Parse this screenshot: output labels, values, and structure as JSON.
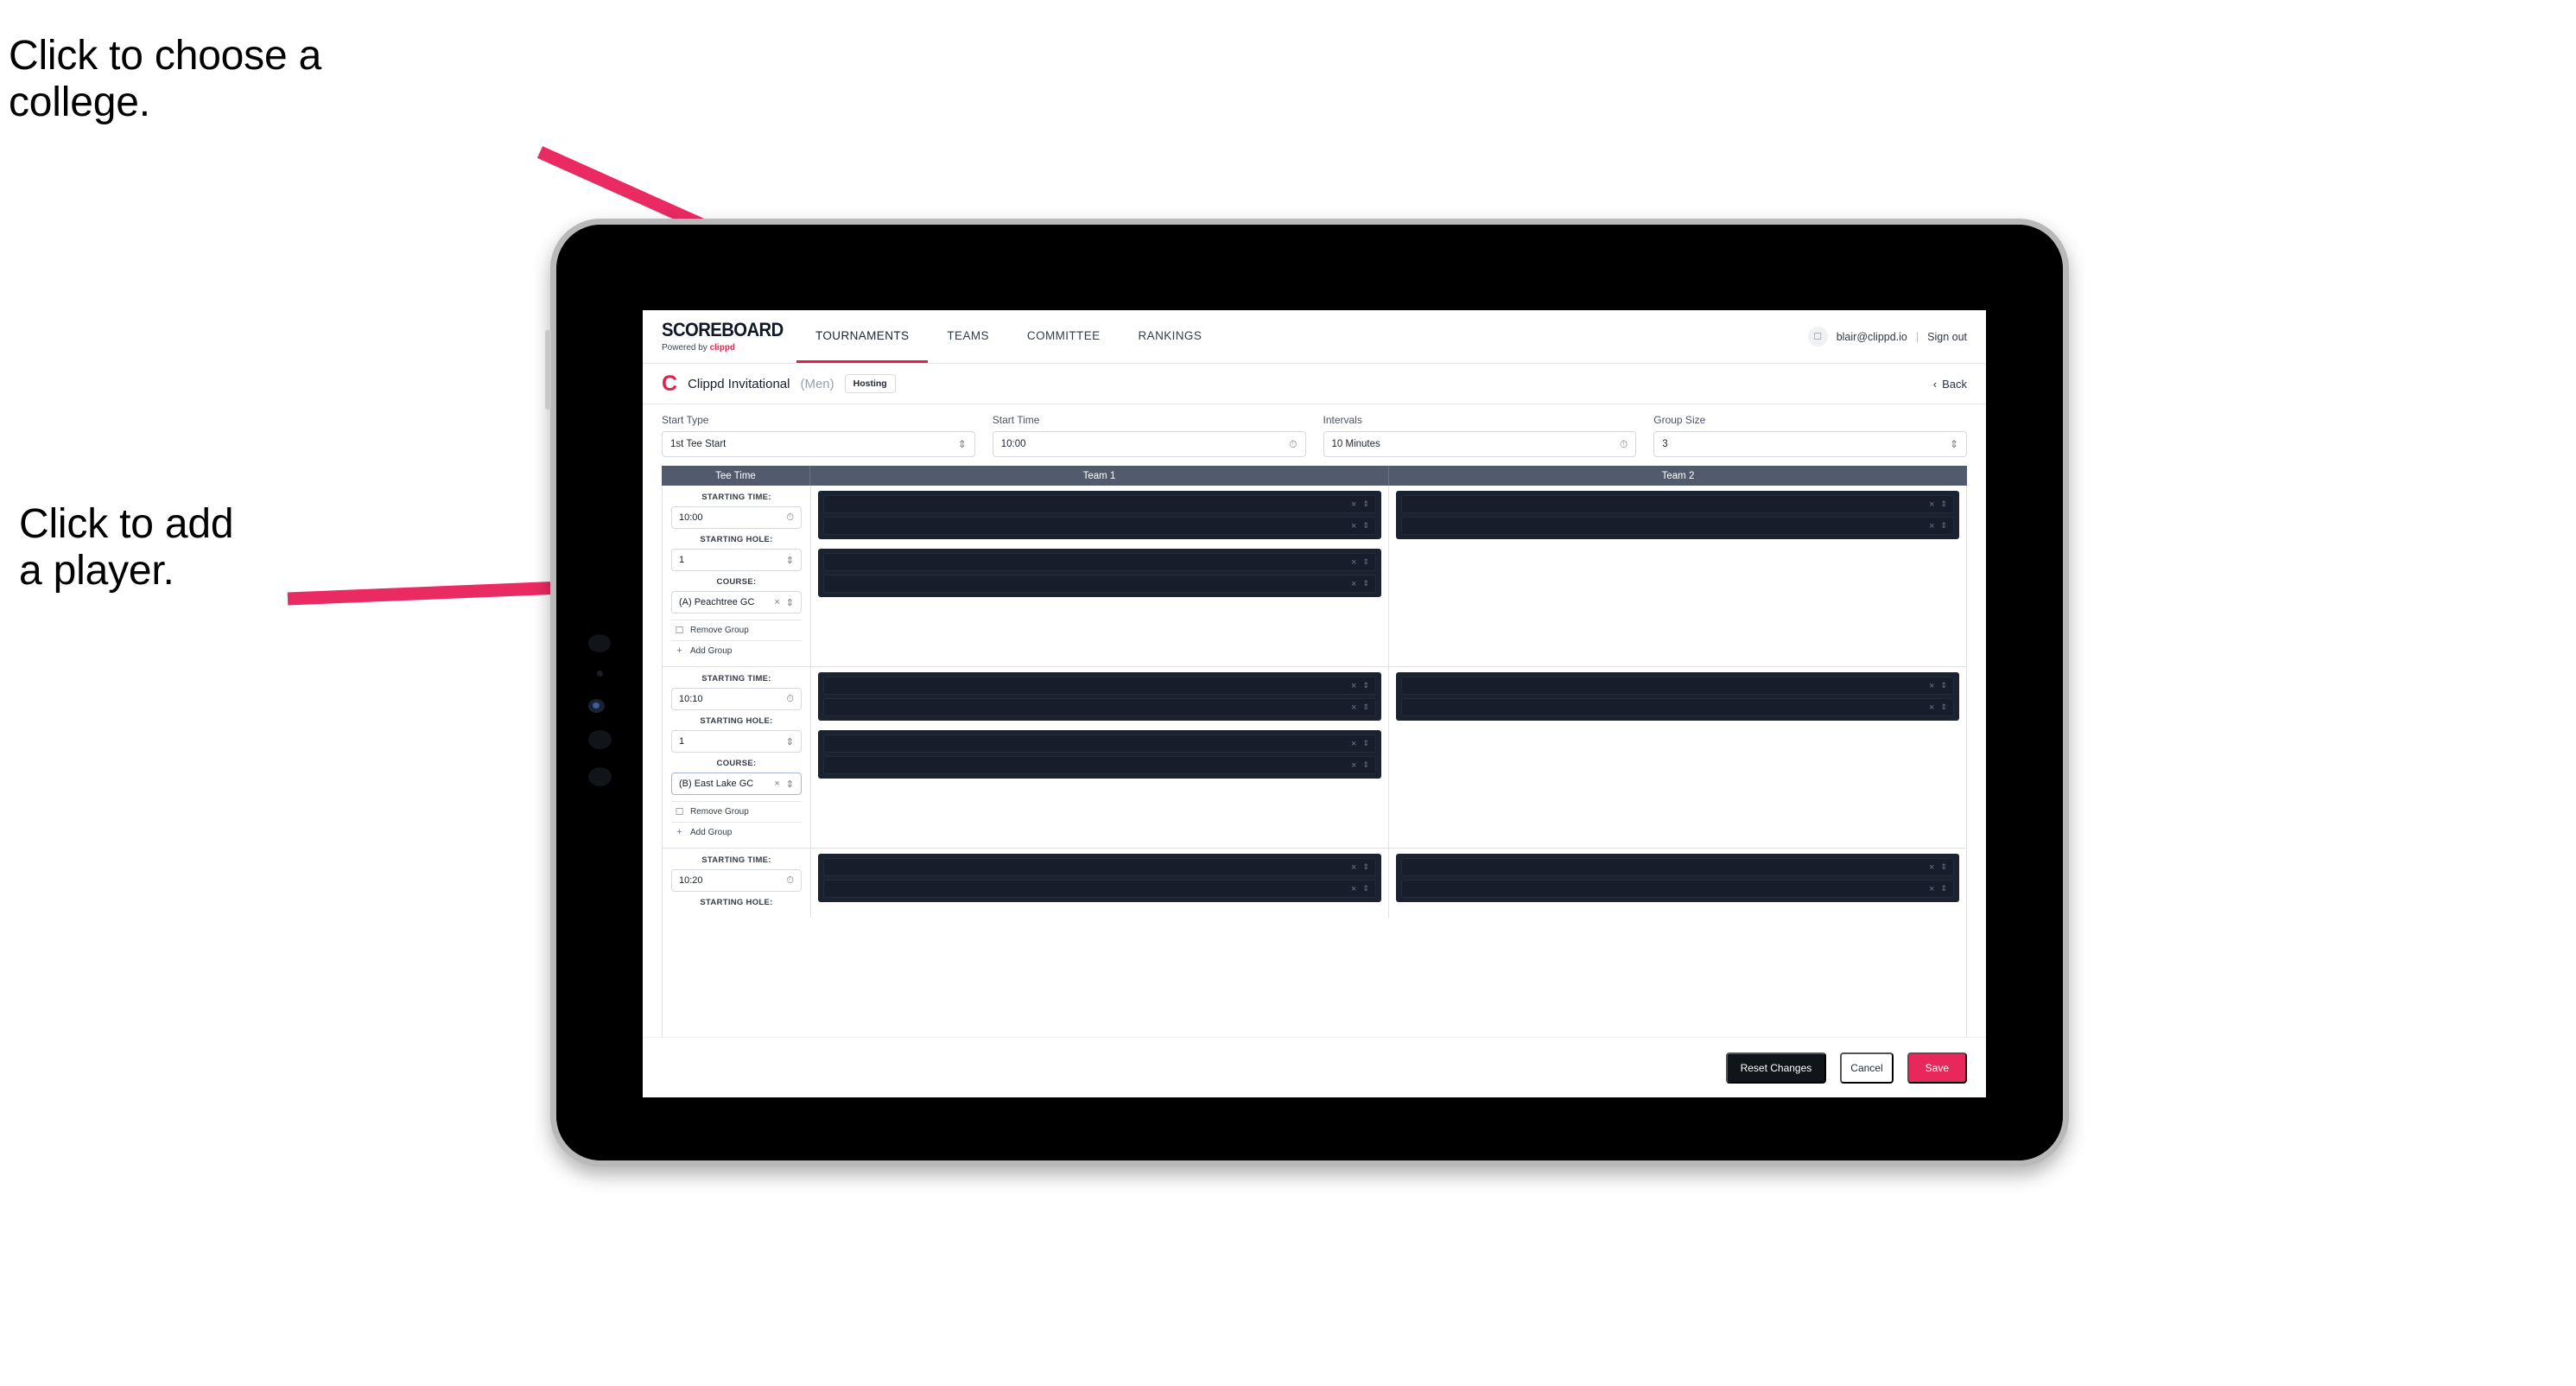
{
  "annotations": [
    {
      "id": "college",
      "text": "Click to choose a\ncollege."
    },
    {
      "id": "player",
      "text": "Click to add\na player."
    }
  ],
  "accent_colors": {
    "arrow_pink": "#ea2a63",
    "brand_red": "#e0234d",
    "save_pink": "#e8275a",
    "table_header": "#525b6e",
    "panel_dark": "#1b2230",
    "slot_dark": "#161d2b"
  },
  "app": {
    "brand": {
      "title": "SCOREBOARD",
      "powered_prefix": "Powered by ",
      "powered_name": "clippd"
    },
    "nav_tabs": [
      {
        "label": "TOURNAMENTS",
        "active": true
      },
      {
        "label": "TEAMS",
        "active": false
      },
      {
        "label": "COMMITTEE",
        "active": false
      },
      {
        "label": "RANKINGS",
        "active": false
      }
    ],
    "user": {
      "avatar_icon": "user-avatar-icon",
      "email": "blair@clippd.io",
      "separator": "|",
      "sign_out": "Sign out"
    },
    "tournament": {
      "logo_letter": "C",
      "name": "Clippd Invitational",
      "gender": "(Men)",
      "hosting_badge": "Hosting",
      "back_label": "Back",
      "back_icon": "chevron-left-icon"
    },
    "controls": [
      {
        "label": "Start Type",
        "value": "1st Tee Start",
        "icon": "chevron-updown-icon"
      },
      {
        "label": "Start Time",
        "value": "10:00",
        "icon": "clock-icon"
      },
      {
        "label": "Intervals",
        "value": "10 Minutes",
        "icon": "clock-icon"
      },
      {
        "label": "Group Size",
        "value": "3",
        "icon": "chevron-updown-icon"
      }
    ],
    "table": {
      "headers": [
        "Tee Time",
        "Team 1",
        "Team 2"
      ],
      "field_labels": {
        "starting_time": "STARTING TIME:",
        "starting_hole": "STARTING HOLE:",
        "course": "COURSE:"
      },
      "group_actions": {
        "remove": "Remove Group",
        "remove_icon": "trash-icon",
        "add": "Add Group",
        "add_icon": "plus-icon"
      },
      "slot_icons": {
        "clear": "close-x-icon",
        "expand": "chevron-updown-icon"
      },
      "rows": [
        {
          "starting_time": "10:00",
          "starting_hole": "1",
          "course": "(A) Peachtree GC",
          "course_focused": false,
          "show_group_actions": true,
          "team1_groups": [
            {
              "slots": [
                {
                  "player": ""
                },
                {
                  "player": ""
                }
              ]
            },
            {
              "slots": [
                {
                  "player": ""
                },
                {
                  "player": ""
                }
              ]
            }
          ],
          "team2_groups": [
            {
              "slots": [
                {
                  "player": ""
                },
                {
                  "player": ""
                }
              ]
            }
          ]
        },
        {
          "starting_time": "10:10",
          "starting_hole": "1",
          "course": "(B) East Lake GC",
          "course_focused": true,
          "show_group_actions": true,
          "team1_groups": [
            {
              "slots": [
                {
                  "player": ""
                },
                {
                  "player": ""
                }
              ]
            },
            {
              "slots": [
                {
                  "player": ""
                },
                {
                  "player": ""
                }
              ]
            }
          ],
          "team2_groups": [
            {
              "slots": [
                {
                  "player": ""
                },
                {
                  "player": ""
                }
              ]
            }
          ]
        },
        {
          "starting_time": "10:20",
          "starting_hole": "",
          "course": "",
          "course_focused": false,
          "show_group_actions": false,
          "team1_groups": [
            {
              "slots": [
                {
                  "player": ""
                },
                {
                  "player": ""
                }
              ]
            }
          ],
          "team2_groups": [
            {
              "slots": [
                {
                  "player": ""
                },
                {
                  "player": ""
                }
              ]
            }
          ]
        }
      ]
    },
    "footer": {
      "reset": "Reset Changes",
      "cancel": "Cancel",
      "save": "Save"
    }
  }
}
